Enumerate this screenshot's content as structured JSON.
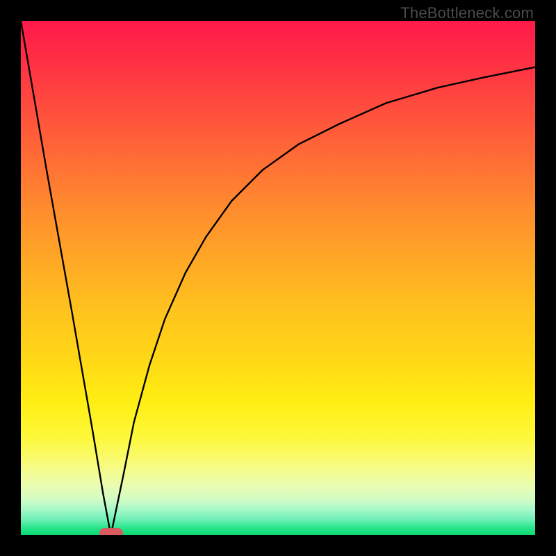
{
  "watermark": {
    "text": "TheBottleneck.com"
  },
  "colors": {
    "frame": "#000000",
    "curve": "#000000",
    "marker": "#d95a5f",
    "gradient_top": "#ff1a4b",
    "gradient_bottom": "#08db6f"
  },
  "chart_data": {
    "type": "line",
    "title": "",
    "xlabel": "",
    "ylabel": "",
    "xlim": [
      0,
      100
    ],
    "ylim": [
      0,
      100
    ],
    "grid": false,
    "legend": false,
    "series": [
      {
        "name": "left-descent",
        "x": [
          0,
          5,
          10,
          14,
          16,
          17.5
        ],
        "values": [
          100,
          71,
          43,
          20,
          8,
          0
        ]
      },
      {
        "name": "right-ascent",
        "x": [
          17.5,
          20,
          22,
          25,
          28,
          32,
          36,
          41,
          47,
          54,
          62,
          71,
          81,
          90,
          100
        ],
        "values": [
          0,
          12,
          22,
          33,
          42,
          51,
          58,
          65,
          71,
          76,
          80,
          84,
          87,
          89,
          91
        ]
      }
    ],
    "marker": {
      "x": 17.5,
      "y": 0,
      "shape": "pill",
      "color": "#d95a5f"
    },
    "background": {
      "type": "vertical-gradient",
      "stops": [
        {
          "pos": 0.0,
          "color": "#ff1a4b"
        },
        {
          "pos": 0.5,
          "color": "#ffbf22"
        },
        {
          "pos": 0.8,
          "color": "#fff22e"
        },
        {
          "pos": 0.92,
          "color": "#e9fcb6"
        },
        {
          "pos": 1.0,
          "color": "#08db6f"
        }
      ]
    }
  }
}
